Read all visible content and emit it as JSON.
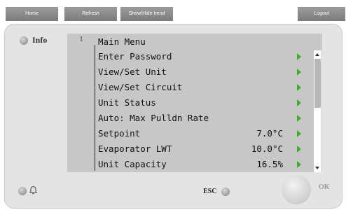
{
  "toolbar": {
    "home": "Home",
    "refresh": "Refresh",
    "show_hide_trend": "Show/Hide trend",
    "logout": "Logout"
  },
  "panel": {
    "info_label": "Info",
    "page_number": "1",
    "esc_label": "ESC",
    "ok_label": "OK"
  },
  "menu": {
    "title": "Main Menu",
    "items": [
      {
        "label": "Enter Password",
        "value": ""
      },
      {
        "label": "View/Set Unit",
        "value": ""
      },
      {
        "label": "View/Set Circuit",
        "value": ""
      },
      {
        "label": "Unit Status",
        "value": ""
      },
      {
        "label": "Auto: Max Pulldn Rate",
        "value": ""
      },
      {
        "label": "Setpoint",
        "value": "7.0°C"
      },
      {
        "label": "Evaporator LWT",
        "value": "10.0°C"
      },
      {
        "label": "Unit Capacity",
        "value": "16.5%"
      }
    ]
  },
  "colors": {
    "toolbar_button": "#8a8a8a",
    "arrow": "#3fae2a",
    "screen": "#c7c7c7",
    "panel": "#e4e4e4"
  }
}
